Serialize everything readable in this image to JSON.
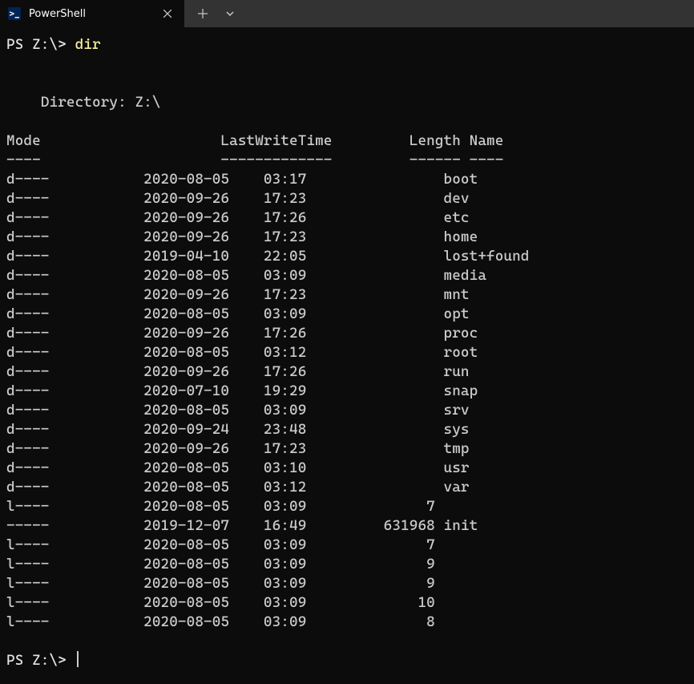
{
  "tab": {
    "title": "PowerShell"
  },
  "prompt": "PS Z:\\>",
  "command": "dir",
  "directory_label": "Directory: Z:\\",
  "headers": {
    "mode": "Mode",
    "lastwrite": "LastWriteTime",
    "length": "Length",
    "name": "Name"
  },
  "dashes": {
    "mode": "----",
    "lastwrite": "-------------",
    "length": "------",
    "name": "----"
  },
  "rows": [
    {
      "mode": "d----",
      "date": "2020-08-05",
      "time": "03:17",
      "length": "",
      "name": "boot"
    },
    {
      "mode": "d----",
      "date": "2020-09-26",
      "time": "17:23",
      "length": "",
      "name": "dev"
    },
    {
      "mode": "d----",
      "date": "2020-09-26",
      "time": "17:26",
      "length": "",
      "name": "etc"
    },
    {
      "mode": "d----",
      "date": "2020-09-26",
      "time": "17:23",
      "length": "",
      "name": "home"
    },
    {
      "mode": "d----",
      "date": "2019-04-10",
      "time": "22:05",
      "length": "",
      "name": "lost+found"
    },
    {
      "mode": "d----",
      "date": "2020-08-05",
      "time": "03:09",
      "length": "",
      "name": "media"
    },
    {
      "mode": "d----",
      "date": "2020-09-26",
      "time": "17:23",
      "length": "",
      "name": "mnt"
    },
    {
      "mode": "d----",
      "date": "2020-08-05",
      "time": "03:09",
      "length": "",
      "name": "opt"
    },
    {
      "mode": "d----",
      "date": "2020-09-26",
      "time": "17:26",
      "length": "",
      "name": "proc"
    },
    {
      "mode": "d----",
      "date": "2020-08-05",
      "time": "03:12",
      "length": "",
      "name": "root"
    },
    {
      "mode": "d----",
      "date": "2020-09-26",
      "time": "17:26",
      "length": "",
      "name": "run"
    },
    {
      "mode": "d----",
      "date": "2020-07-10",
      "time": "19:29",
      "length": "",
      "name": "snap"
    },
    {
      "mode": "d----",
      "date": "2020-08-05",
      "time": "03:09",
      "length": "",
      "name": "srv"
    },
    {
      "mode": "d----",
      "date": "2020-09-24",
      "time": "23:48",
      "length": "",
      "name": "sys"
    },
    {
      "mode": "d----",
      "date": "2020-09-26",
      "time": "17:23",
      "length": "",
      "name": "tmp"
    },
    {
      "mode": "d----",
      "date": "2020-08-05",
      "time": "03:10",
      "length": "",
      "name": "usr"
    },
    {
      "mode": "d----",
      "date": "2020-08-05",
      "time": "03:12",
      "length": "",
      "name": "var"
    },
    {
      "mode": "l----",
      "date": "2020-08-05",
      "time": "03:09",
      "length": "7",
      "name": ""
    },
    {
      "mode": "-----",
      "date": "2019-12-07",
      "time": "16:49",
      "length": "631968",
      "name": "init"
    },
    {
      "mode": "l----",
      "date": "2020-08-05",
      "time": "03:09",
      "length": "7",
      "name": ""
    },
    {
      "mode": "l----",
      "date": "2020-08-05",
      "time": "03:09",
      "length": "9",
      "name": ""
    },
    {
      "mode": "l----",
      "date": "2020-08-05",
      "time": "03:09",
      "length": "9",
      "name": ""
    },
    {
      "mode": "l----",
      "date": "2020-08-05",
      "time": "03:09",
      "length": "10",
      "name": ""
    },
    {
      "mode": "l----",
      "date": "2020-08-05",
      "time": "03:09",
      "length": "8",
      "name": ""
    }
  ],
  "prompt2": "PS Z:\\>"
}
